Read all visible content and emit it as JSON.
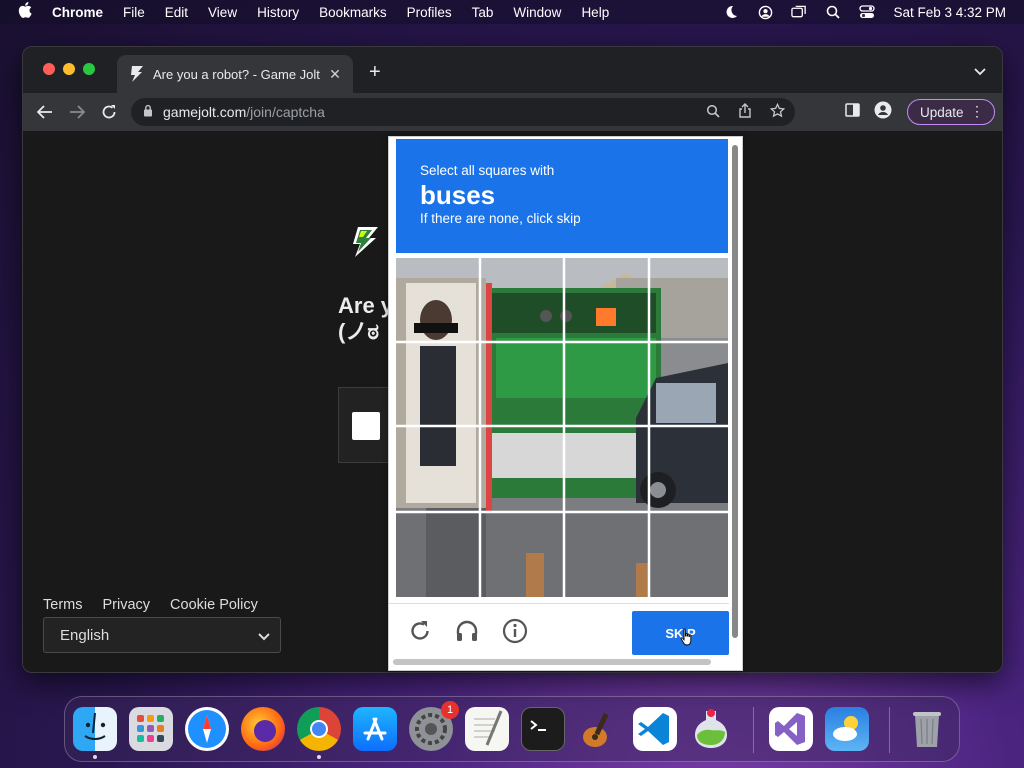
{
  "menubar": {
    "app": "Chrome",
    "items": [
      "File",
      "Edit",
      "View",
      "History",
      "Bookmarks",
      "Profiles",
      "Tab",
      "Window",
      "Help"
    ],
    "clock": "Sat Feb 3  4:32 PM"
  },
  "browser": {
    "tab_title": "Are you a robot? - Game Jolt",
    "url_host": "gamejolt.com",
    "url_path": "/join/captcha",
    "update_label": "Update"
  },
  "page": {
    "heading_line1": "Are y",
    "heading_line2": "(ノಠ",
    "footer_links": [
      "Terms",
      "Privacy",
      "Cookie Policy"
    ],
    "language": "English"
  },
  "captcha": {
    "instruction": "Select all squares with",
    "target": "buses",
    "hint": "If there are none, click skip",
    "skip_label": "SKIP"
  },
  "dock": {
    "badge_count": "1"
  },
  "colors": {
    "captcha_blue": "#1a73e8",
    "update_border": "#c58af9"
  }
}
